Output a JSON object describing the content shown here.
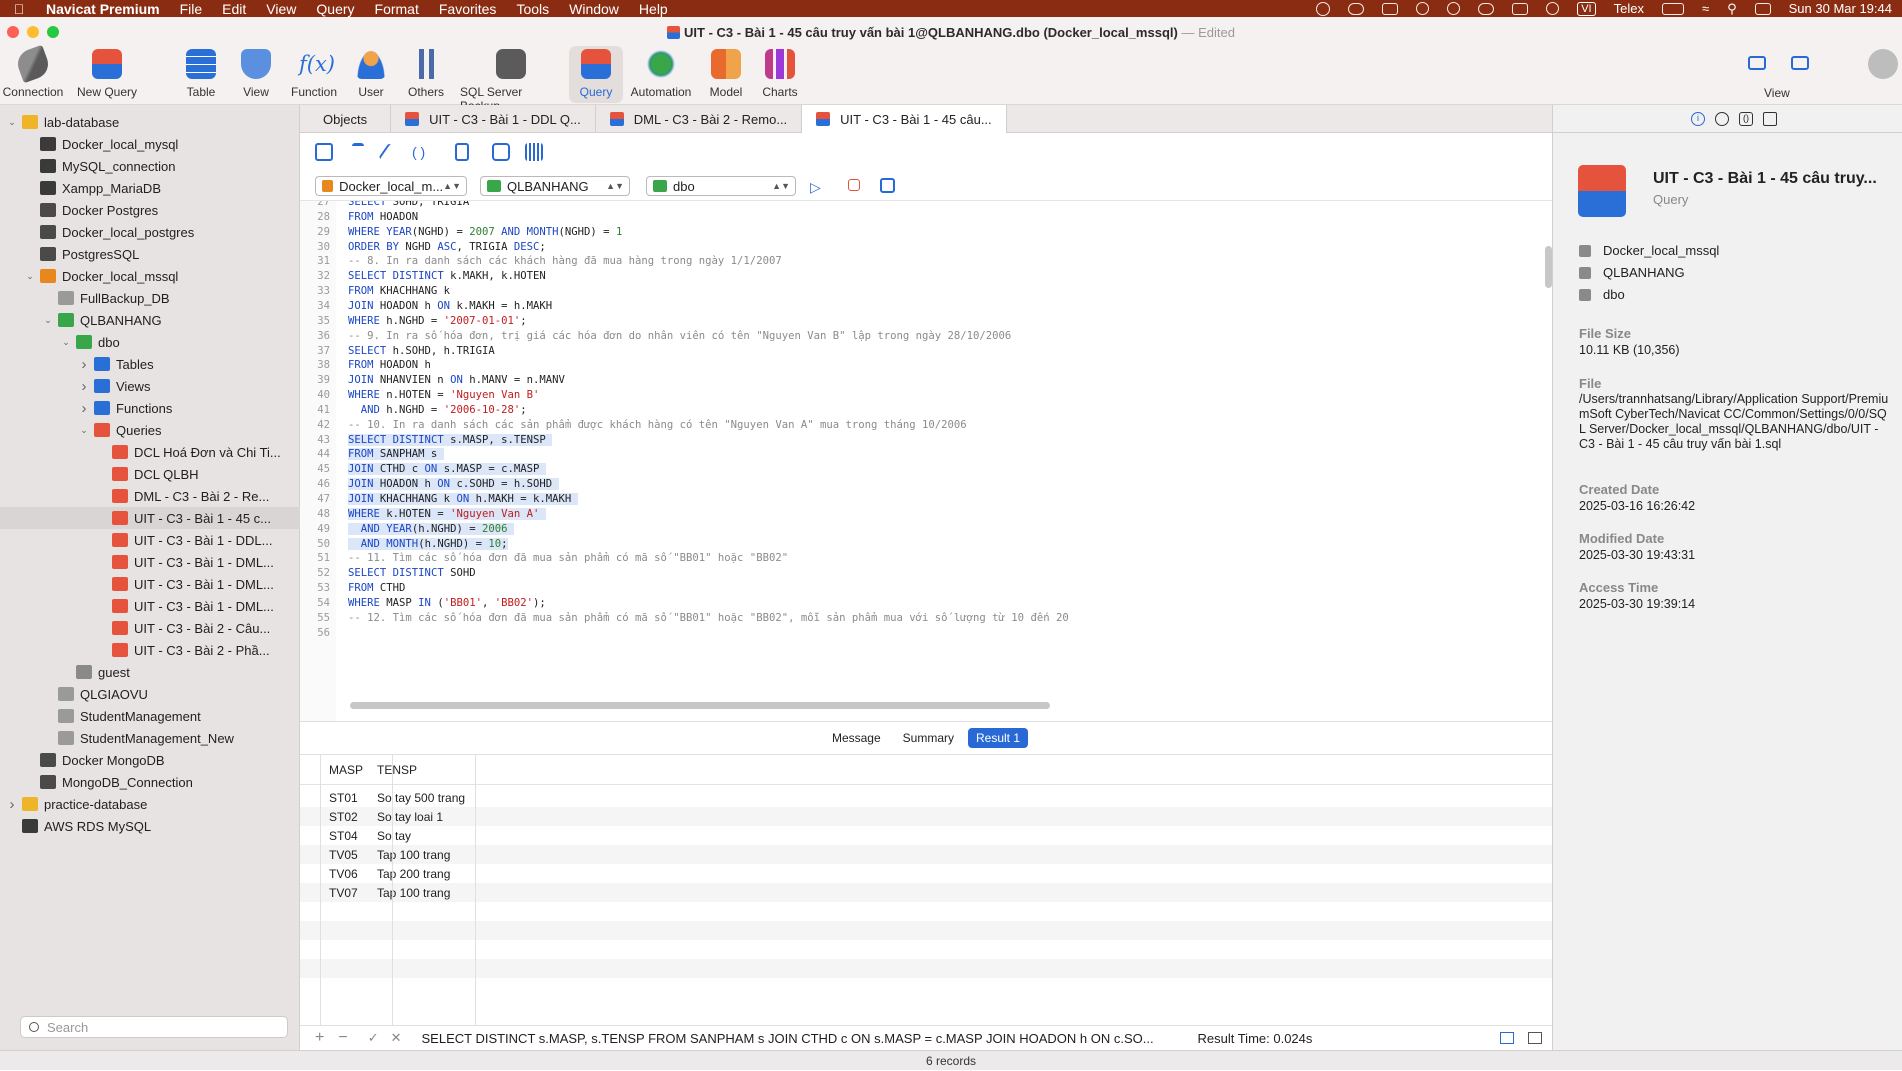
{
  "menubar": {
    "app_name": "Navicat Premium",
    "items": [
      "File",
      "Edit",
      "View",
      "Query",
      "Format",
      "Favorites",
      "Tools",
      "Window",
      "Help"
    ],
    "input_method": "Telex",
    "clock": "Sun 30 Mar  19:44"
  },
  "window": {
    "title": "UIT - C3 - Bài 1 - 45 câu truy vấn bài 1@QLBANHANG.dbo (Docker_local_mssql)",
    "edited_label": "— Edited"
  },
  "toolbar": {
    "connection": "Connection",
    "new_query": "New Query",
    "table": "Table",
    "view": "View",
    "function": "Function",
    "user": "User",
    "others": "Others",
    "sql_server_backup": "SQL Server Backup",
    "query": "Query",
    "automation": "Automation",
    "model": "Model",
    "charts": "Charts",
    "view_right": "View"
  },
  "sidebar": {
    "search_placeholder": "Search",
    "items": [
      {
        "label": "lab-database",
        "indent": 0,
        "caret": "v",
        "icon": "folder-icon",
        "color": "#f0b429"
      },
      {
        "label": "Docker_local_mysql",
        "indent": 1,
        "caret": "",
        "icon": "mysql-icon",
        "color": "#3a3a3a"
      },
      {
        "label": "MySQL_connection",
        "indent": 1,
        "caret": "",
        "icon": "mysql-icon",
        "color": "#3a3a3a"
      },
      {
        "label": "Xampp_MariaDB",
        "indent": 1,
        "caret": "",
        "icon": "mariadb-icon",
        "color": "#3a3a3a"
      },
      {
        "label": "Docker Postgres",
        "indent": 1,
        "caret": "",
        "icon": "postgres-icon",
        "color": "#4a4a4a"
      },
      {
        "label": "Docker_local_postgres",
        "indent": 1,
        "caret": "",
        "icon": "postgres-icon",
        "color": "#4a4a4a"
      },
      {
        "label": "PostgresSQL",
        "indent": 1,
        "caret": "",
        "icon": "postgres-icon",
        "color": "#4a4a4a"
      },
      {
        "label": "Docker_local_mssql",
        "indent": 1,
        "caret": "v",
        "icon": "mssql-icon",
        "color": "#e8871e"
      },
      {
        "label": "FullBackup_DB",
        "indent": 2,
        "caret": "",
        "icon": "database-icon",
        "color": "#9a9a9a"
      },
      {
        "label": "QLBANHANG",
        "indent": 2,
        "caret": "v",
        "icon": "database-icon",
        "color": "#3aa64a"
      },
      {
        "label": "dbo",
        "indent": 3,
        "caret": "v",
        "icon": "schema-icon",
        "color": "#3aa64a"
      },
      {
        "label": "Tables",
        "indent": 4,
        "caret": ">",
        "icon": "table-icon",
        "color": "#2a6fd8"
      },
      {
        "label": "Views",
        "indent": 4,
        "caret": ">",
        "icon": "views-icon",
        "color": "#2a6fd8"
      },
      {
        "label": "Functions",
        "indent": 4,
        "caret": ">",
        "icon": "function-icon",
        "color": "#2a6fd8"
      },
      {
        "label": "Queries",
        "indent": 4,
        "caret": "v",
        "icon": "query-icon",
        "color": "#e5533c"
      },
      {
        "label": "DCL Hoá Đơn và Chi Ti...",
        "indent": 5,
        "caret": "",
        "icon": "query-icon",
        "color": "#e5533c"
      },
      {
        "label": "DCL QLBH",
        "indent": 5,
        "caret": "",
        "icon": "query-icon",
        "color": "#e5533c"
      },
      {
        "label": "DML - C3 - Bài 2 - Re...",
        "indent": 5,
        "caret": "",
        "icon": "query-icon",
        "color": "#e5533c"
      },
      {
        "label": "UIT - C3 - Bài 1 - 45 c...",
        "indent": 5,
        "caret": "",
        "icon": "query-icon",
        "color": "#e5533c",
        "selected": true
      },
      {
        "label": "UIT - C3 - Bài 1 - DDL...",
        "indent": 5,
        "caret": "",
        "icon": "query-icon",
        "color": "#e5533c"
      },
      {
        "label": "UIT - C3 - Bài 1 - DML...",
        "indent": 5,
        "caret": "",
        "icon": "query-icon",
        "color": "#e5533c"
      },
      {
        "label": "UIT - C3 - Bài 1 - DML...",
        "indent": 5,
        "caret": "",
        "icon": "query-icon",
        "color": "#e5533c"
      },
      {
        "label": "UIT - C3 - Bài 1 - DML...",
        "indent": 5,
        "caret": "",
        "icon": "query-icon",
        "color": "#e5533c"
      },
      {
        "label": "UIT - C3 - Bài 2 - Câu...",
        "indent": 5,
        "caret": "",
        "icon": "query-icon",
        "color": "#e5533c"
      },
      {
        "label": "UIT - C3 - Bài 2 - Phầ...",
        "indent": 5,
        "caret": "",
        "icon": "query-icon",
        "color": "#e5533c"
      },
      {
        "label": "guest",
        "indent": 3,
        "caret": "",
        "icon": "schema-icon",
        "color": "#8a8a8a"
      },
      {
        "label": "QLGIAOVU",
        "indent": 2,
        "caret": "",
        "icon": "database-icon",
        "color": "#9a9a9a"
      },
      {
        "label": "StudentManagement",
        "indent": 2,
        "caret": "",
        "icon": "database-icon",
        "color": "#9a9a9a"
      },
      {
        "label": "StudentManagement_New",
        "indent": 2,
        "caret": "",
        "icon": "database-icon",
        "color": "#9a9a9a"
      },
      {
        "label": "Docker MongoDB",
        "indent": 1,
        "caret": "",
        "icon": "mongodb-icon",
        "color": "#4a4a4a"
      },
      {
        "label": "MongoDB_Connection",
        "indent": 1,
        "caret": "",
        "icon": "mongodb-icon",
        "color": "#4a4a4a"
      },
      {
        "label": "practice-database",
        "indent": 0,
        "caret": ">",
        "icon": "folder-icon",
        "color": "#f0b429"
      },
      {
        "label": "AWS RDS MySQL",
        "indent": 0,
        "caret": "",
        "icon": "mysql-icon",
        "color": "#3a3a3a"
      }
    ]
  },
  "tabs": [
    {
      "label": "Objects",
      "has_icon": false
    },
    {
      "label": "UIT - C3 - Bài 1 - DDL Q...",
      "has_icon": true
    },
    {
      "label": "DML - C3 - Bài 2 - Remo...",
      "has_icon": true
    },
    {
      "label": "UIT - C3 - Bài 1 - 45 câu...",
      "has_icon": true,
      "active": true
    }
  ],
  "selectors": {
    "connection": "Docker_local_m...",
    "database": "QLBANHANG",
    "schema": "dbo"
  },
  "editor": {
    "lines": [
      {
        "n": "27",
        "t": "SELECT SOHD, TRIGIA",
        "hl": false
      },
      {
        "n": "28",
        "t": "FROM HOADON",
        "hl": false
      },
      {
        "n": "29",
        "t": "WHERE YEAR(NGHD) = 2007 AND MONTH(NGHD) = 1",
        "hl": false
      },
      {
        "n": "30",
        "t": "ORDER BY NGHD ASC, TRIGIA DESC;",
        "hl": false
      },
      {
        "n": "31",
        "t": "-- 8. In ra danh sách các khách hàng đã mua hàng trong ngày 1/1/2007",
        "hl": false
      },
      {
        "n": "32",
        "t": "SELECT DISTINCT k.MAKH, k.HOTEN",
        "hl": false
      },
      {
        "n": "33",
        "t": "FROM KHACHHANG k",
        "hl": false
      },
      {
        "n": "34",
        "t": "JOIN HOADON h ON k.MAKH = h.MAKH",
        "hl": false
      },
      {
        "n": "35",
        "t": "WHERE h.NGHD = '2007-01-01';",
        "hl": false
      },
      {
        "n": "36",
        "t": "-- 9. In ra số hóa đơn, trị giá các hóa đơn do nhân viên có tên \"Nguyen Van B\" lập trong ngày 28/10/2006",
        "hl": false
      },
      {
        "n": "37",
        "t": "SELECT h.SOHD, h.TRIGIA",
        "hl": false
      },
      {
        "n": "38",
        "t": "FROM HOADON h",
        "hl": false
      },
      {
        "n": "39",
        "t": "JOIN NHANVIEN n ON h.MANV = n.MANV",
        "hl": false
      },
      {
        "n": "40",
        "t": "WHERE n.HOTEN = 'Nguyen Van B'",
        "hl": false
      },
      {
        "n": "41",
        "t": "  AND h.NGHD = '2006-10-28';",
        "hl": false
      },
      {
        "n": "42",
        "t": "-- 10. In ra danh sách các sản phẩm được khách hàng có tên \"Nguyen Van A\" mua trong tháng 10/2006",
        "hl": false
      },
      {
        "n": "43",
        "t": "SELECT DISTINCT s.MASP, s.TENSP ",
        "hl": true
      },
      {
        "n": "44",
        "t": "FROM SANPHAM s ",
        "hl": true
      },
      {
        "n": "45",
        "t": "JOIN CTHD c ON s.MASP = c.MASP ",
        "hl": true
      },
      {
        "n": "46",
        "t": "JOIN HOADON h ON c.SOHD = h.SOHD ",
        "hl": true
      },
      {
        "n": "47",
        "t": "JOIN KHACHHANG k ON h.MAKH = k.MAKH ",
        "hl": true
      },
      {
        "n": "48",
        "t": "WHERE k.HOTEN = 'Nguyen Van A' ",
        "hl": true
      },
      {
        "n": "49",
        "t": "  AND YEAR(h.NGHD) = 2006 ",
        "hl": true
      },
      {
        "n": "50",
        "t": "  AND MONTH(h.NGHD) = 10;",
        "hl": true
      },
      {
        "n": "51",
        "t": "-- 11. Tìm các số hóa đơn đã mua sản phẩm có mã số \"BB01\" hoặc \"BB02\"",
        "hl": false
      },
      {
        "n": "52",
        "t": "SELECT DISTINCT SOHD",
        "hl": false
      },
      {
        "n": "53",
        "t": "FROM CTHD",
        "hl": false
      },
      {
        "n": "54",
        "t": "WHERE MASP IN ('BB01', 'BB02');",
        "hl": false
      },
      {
        "n": "55",
        "t": "-- 12. Tìm các số hóa đơn đã mua sản phẩm có mã số \"BB01\" hoặc \"BB02\", mỗi sản phẩm mua với số lượng từ 10 đến 20",
        "hl": false
      },
      {
        "n": "56",
        "t": "",
        "hl": false
      }
    ]
  },
  "result_tabs": {
    "message": "Message",
    "summary": "Summary",
    "result": "Result 1"
  },
  "grid": {
    "columns": [
      "MASP",
      "TENSP"
    ],
    "rows": [
      [
        "ST01",
        "So tay 500 trang"
      ],
      [
        "ST02",
        "So tay loai 1"
      ],
      [
        "ST04",
        "So tay"
      ],
      [
        "TV05",
        "Tap 100 trang"
      ],
      [
        "TV06",
        "Tap 200 trang"
      ],
      [
        "TV07",
        "Tap 100 trang"
      ]
    ]
  },
  "status": {
    "sql_preview": "SELECT DISTINCT s.MASP, s.TENSP  FROM SANPHAM s   JOIN CTHD c ON s.MASP = c.MASP  JOIN HOADON h ON c.SO...",
    "result_time": "Result Time: 0.024s",
    "records": "6 records"
  },
  "right_panel": {
    "title": "UIT - C3 - Bài 1 - 45 câu truy...",
    "subtitle": "Query",
    "connection": "Docker_local_mssql",
    "database": "QLBANHANG",
    "schema": "dbo",
    "file_size_label": "File Size",
    "file_size": "10.11 KB (10,356)",
    "file_label": "File",
    "file_path": "/Users/trannhatsang/Library/Application Support/PremiumSoft CyberTech/Navicat CC/Common/Settings/0/0/SQL Server/Docker_local_mssql/QLBANHANG/dbo/UIT - C3 - Bài 1 - 45 câu truy vấn bài 1.sql",
    "created_label": "Created Date",
    "created": "2025-03-16 16:26:42",
    "modified_label": "Modified Date",
    "modified": "2025-03-30 19:43:31",
    "access_label": "Access Time",
    "access": "2025-03-30 19:39:14"
  },
  "colors": {
    "menubar": "#8a2c12",
    "accent": "#2869d6",
    "selection": "#dbe6f8"
  }
}
